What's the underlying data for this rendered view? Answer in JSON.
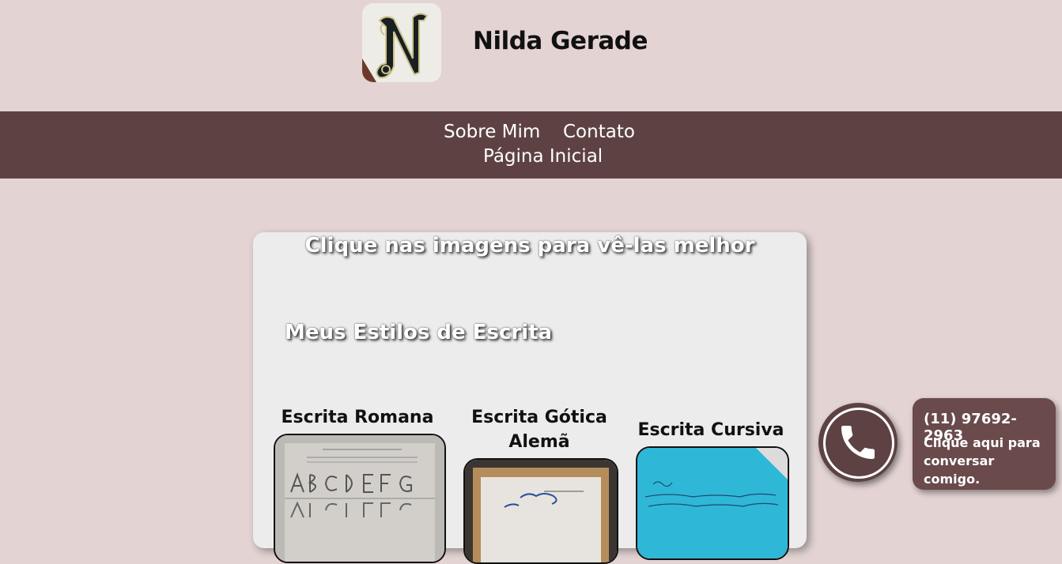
{
  "header": {
    "site_title": "Nilda Gerade",
    "logo_icon": "monogram-n-logo"
  },
  "nav": {
    "items": [
      {
        "label": "Sobre Mim"
      },
      {
        "label": "Contato"
      },
      {
        "label": "Página Inicial"
      }
    ]
  },
  "gallery": {
    "hint": "Clique nas imagens para vê-las melhor",
    "section_title": "Meus Estilos de Escrita",
    "cards": [
      {
        "label": "Escrita Romana"
      },
      {
        "label": "Escrita Gótica Alemã"
      },
      {
        "label": "Escrita Cursiva"
      }
    ]
  },
  "contact": {
    "phone_icon": "phone-icon",
    "phone": "(11) 97692-2963",
    "cta": "Clique aqui para conversar comigo."
  },
  "colors": {
    "background": "#e3d3d3",
    "nav": "#5e4243",
    "panel": "#ececec",
    "contact_box": "#6a4a4b"
  }
}
